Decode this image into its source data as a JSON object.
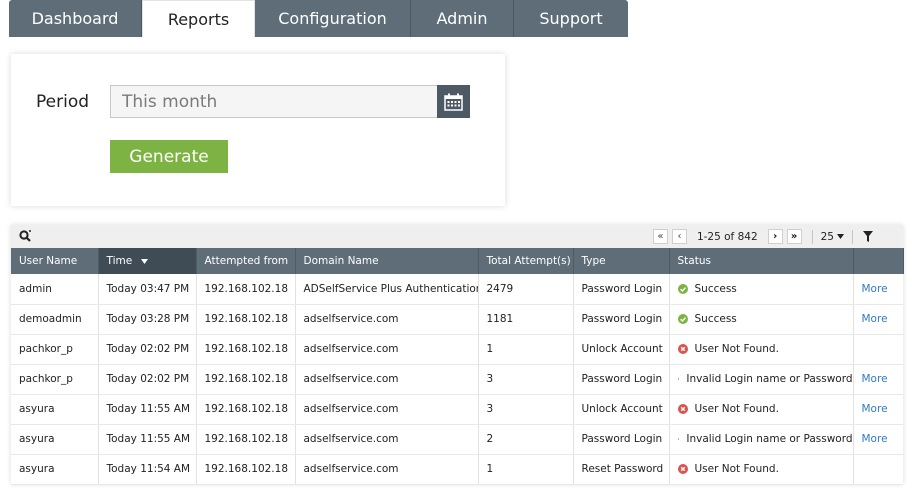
{
  "tabs": [
    {
      "label": "Dashboard",
      "active": false
    },
    {
      "label": "Reports",
      "active": true
    },
    {
      "label": "Configuration",
      "active": false
    },
    {
      "label": "Admin",
      "active": false
    },
    {
      "label": "Support",
      "active": false
    }
  ],
  "form": {
    "period_label": "Period",
    "period_value": "This month",
    "generate_label": "Generate"
  },
  "pager": {
    "first": "«",
    "prev": "‹",
    "range": "1-25 of 842",
    "next": "›",
    "last": "»",
    "page_size": "25"
  },
  "table": {
    "columns": [
      "User Name",
      "Time",
      "Attempted from",
      "Domain Name",
      "Total Attempt(s)",
      "Type",
      "Status",
      ""
    ],
    "sorted_column": "Time",
    "rows": [
      {
        "user": "admin",
        "time": "Today 03:47 PM",
        "from": "192.168.102.18",
        "domain": "ADSelfService Plus Authentication",
        "attempts": "2479",
        "type": "Password Login",
        "status": "Success",
        "status_kind": "success",
        "more": "More"
      },
      {
        "user": "demoadmin",
        "time": "Today 03:28 PM",
        "from": "192.168.102.18",
        "domain": "adselfservice.com",
        "attempts": "1181",
        "type": "Password Login",
        "status": "Success",
        "status_kind": "success",
        "more": "More"
      },
      {
        "user": "pachkor_p",
        "time": "Today 02:02 PM",
        "from": "192.168.102.18",
        "domain": "adselfservice.com",
        "attempts": "1",
        "type": "Unlock Account",
        "status": "User Not Found.",
        "status_kind": "error",
        "more": ""
      },
      {
        "user": "pachkor_p",
        "time": "Today 02:02 PM",
        "from": "192.168.102.18",
        "domain": "adselfservice.com",
        "attempts": "3",
        "type": "Password Login",
        "status": "Invalid Login name or Password",
        "status_kind": "error",
        "more": "More"
      },
      {
        "user": "asyura",
        "time": "Today 11:55 AM",
        "from": "192.168.102.18",
        "domain": "adselfservice.com",
        "attempts": "3",
        "type": "Unlock Account",
        "status": "User Not Found.",
        "status_kind": "error",
        "more": "More"
      },
      {
        "user": "asyura",
        "time": "Today 11:55 AM",
        "from": "192.168.102.18",
        "domain": "adselfservice.com",
        "attempts": "2",
        "type": "Password Login",
        "status": "Invalid Login name or Password",
        "status_kind": "error",
        "more": "More"
      },
      {
        "user": "asyura",
        "time": "Today 11:54 AM",
        "from": "192.168.102.18",
        "domain": "adselfservice.com",
        "attempts": "1",
        "type": "Reset Password",
        "status": "User Not Found.",
        "status_kind": "error",
        "more": ""
      }
    ]
  },
  "colors": {
    "tab_bg": "#5f6d78",
    "header_bg": "#5f6d78",
    "generate_bg": "#7cb342",
    "link": "#2f7bc7",
    "success": "#7cb342",
    "error": "#d9534f"
  }
}
